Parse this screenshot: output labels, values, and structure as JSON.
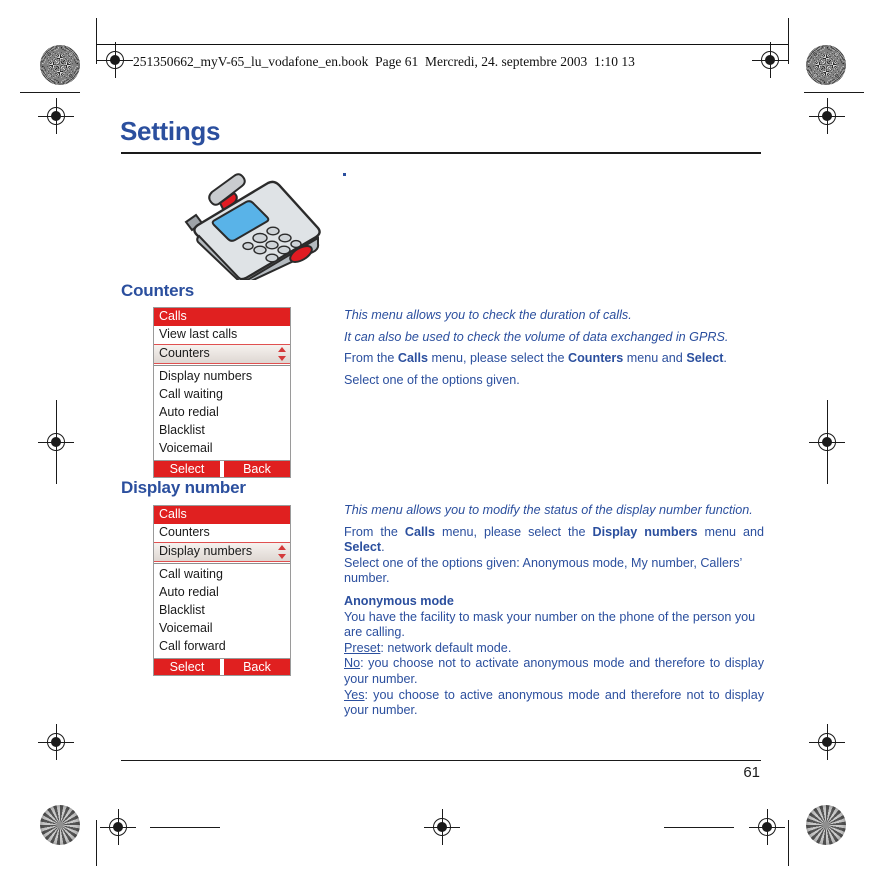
{
  "running_header": {
    "text": "251350662_myV-65_lu_vodafone_en.book  Page 61  Mercredi, 24. septembre 2003  1:10 13"
  },
  "page": {
    "title": "Settings",
    "number": "61",
    "accent_color": "#2b4f9e",
    "screen_accent_color": "#e02020"
  },
  "sections": [
    {
      "heading": "Counters",
      "screen": {
        "title": "Calls",
        "rows_above": [
          "View last calls"
        ],
        "selected": "Counters",
        "rows_below": [
          "Display numbers",
          "Call waiting",
          "Auto redial",
          "Blacklist",
          "Voicemail"
        ],
        "softkey_left": "Select",
        "softkey_right": "Back"
      }
    },
    {
      "heading": "Display number",
      "screen": {
        "title": "Calls",
        "rows_above": [
          "Counters"
        ],
        "selected": "Display numbers",
        "rows_below": [
          "Call waiting",
          "Auto redial",
          "Blacklist",
          "Voicemail",
          "Call forward"
        ],
        "softkey_left": "Select",
        "softkey_right": "Back"
      }
    }
  ],
  "counters_body": {
    "p1": "This menu allows you to check the duration of calls.",
    "p2": "It can also be used to check the volume of data exchanged in GPRS.",
    "p3_a": "From the ",
    "p3_b": "Calls",
    "p3_c": " menu, please select the ",
    "p3_d": "Counters",
    "p3_e": " menu and ",
    "p3_f": "Select",
    "p3_g": ".",
    "p4": "Select one of the options given."
  },
  "display_body": {
    "p1": "This menu allows you to modify the status of the display number function.",
    "p2_a": "From the ",
    "p2_b": "Calls",
    "p2_c": " menu, please select the ",
    "p2_d": "Display numbers",
    "p2_e": " menu and ",
    "p2_f": "Select",
    "p2_g": ".",
    "p3": "Select one of the options given: Anonymous mode, My number, Callers’ number.",
    "anon_heading": "Anonymous mode",
    "anon_p1": "You have the facility to mask your number on the phone of the person you are calling.",
    "preset_label": "Preset",
    "preset_text": ": network default mode.",
    "no_label": "No",
    "no_text": ": you choose not to activate anonymous mode and therefore to display your number.",
    "yes_label": "Yes",
    "yes_text": ": you choose to active anonymous mode and therefore not to display your number."
  }
}
